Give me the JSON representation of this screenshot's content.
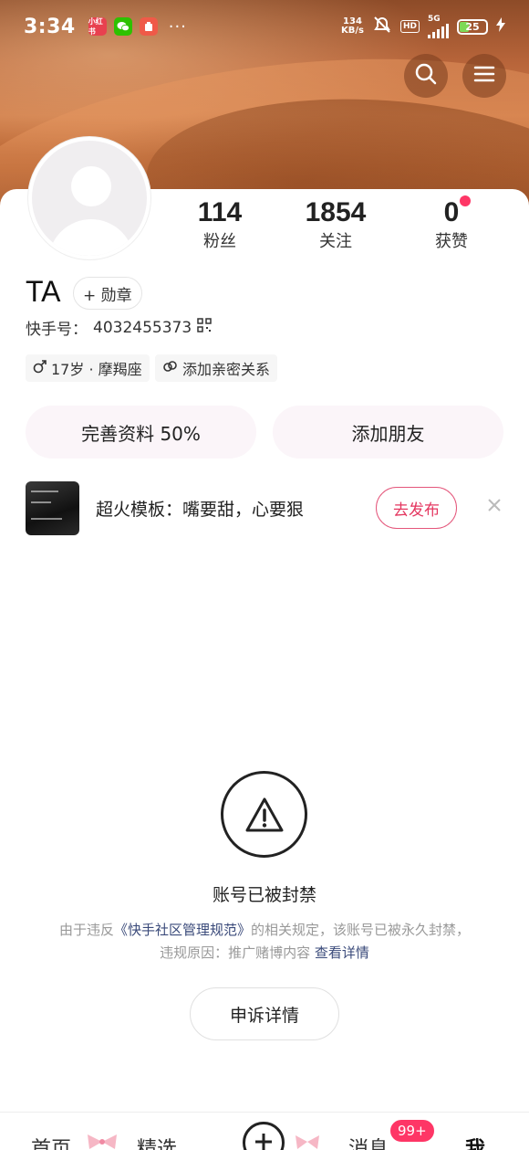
{
  "status_bar": {
    "time": "3:34",
    "app_icons": [
      "xiaohongshu-icon",
      "wechat-icon",
      "red-app-icon"
    ],
    "more": "···",
    "net_speed_value": "134",
    "net_speed_unit": "KB/s",
    "hd": "HD",
    "signal_label": "5G",
    "battery": "25",
    "charging_icon": "bolt-icon",
    "colors": {
      "battery_fill": "#7ed957"
    }
  },
  "header": {
    "search_icon": "search-icon",
    "menu_icon": "menu-icon"
  },
  "profile": {
    "stats": [
      {
        "value": "114",
        "label": "粉丝"
      },
      {
        "value": "1854",
        "label": "关注"
      },
      {
        "value": "0",
        "label": "获赞",
        "has_red_dot": true
      }
    ],
    "name": "TA",
    "medal_button": "+ 勋章",
    "kuaishou_id_label": "快手号：",
    "kuaishou_id": "4032455373",
    "tags": [
      {
        "icon": "male-icon",
        "text": "17岁 · 摩羯座"
      },
      {
        "icon": "link-icon",
        "text": "添加亲密关系"
      }
    ],
    "actions": {
      "complete_profile": "完善资料 50%",
      "add_friend": "添加朋友"
    }
  },
  "promo": {
    "text": "超火模板：嘴要甜，心要狠",
    "publish_button": "去发布",
    "close_icon": "close-icon"
  },
  "ban_notice": {
    "icon": "warning-icon",
    "title": "账号已被封禁",
    "desc_prefix": "由于违反",
    "desc_link": "《快手社区管理规范》",
    "desc_middle": "的相关规定，该账号已被永久封禁，违规原因：推广赌博内容",
    "desc_detail_link": "查看详情",
    "appeal_button": "申诉详情"
  },
  "bottom_nav": {
    "home": "首页",
    "featured": "精选",
    "plus_icon": "plus-icon",
    "messages": "消息",
    "messages_badge": "99+",
    "me": "我",
    "colors": {
      "badge": "#fe3666"
    }
  },
  "colors": {
    "accent": "#fe3666",
    "publish_border": "#e4567b",
    "link": "#3a4a7a",
    "action_bg": "#fbf5f9"
  }
}
